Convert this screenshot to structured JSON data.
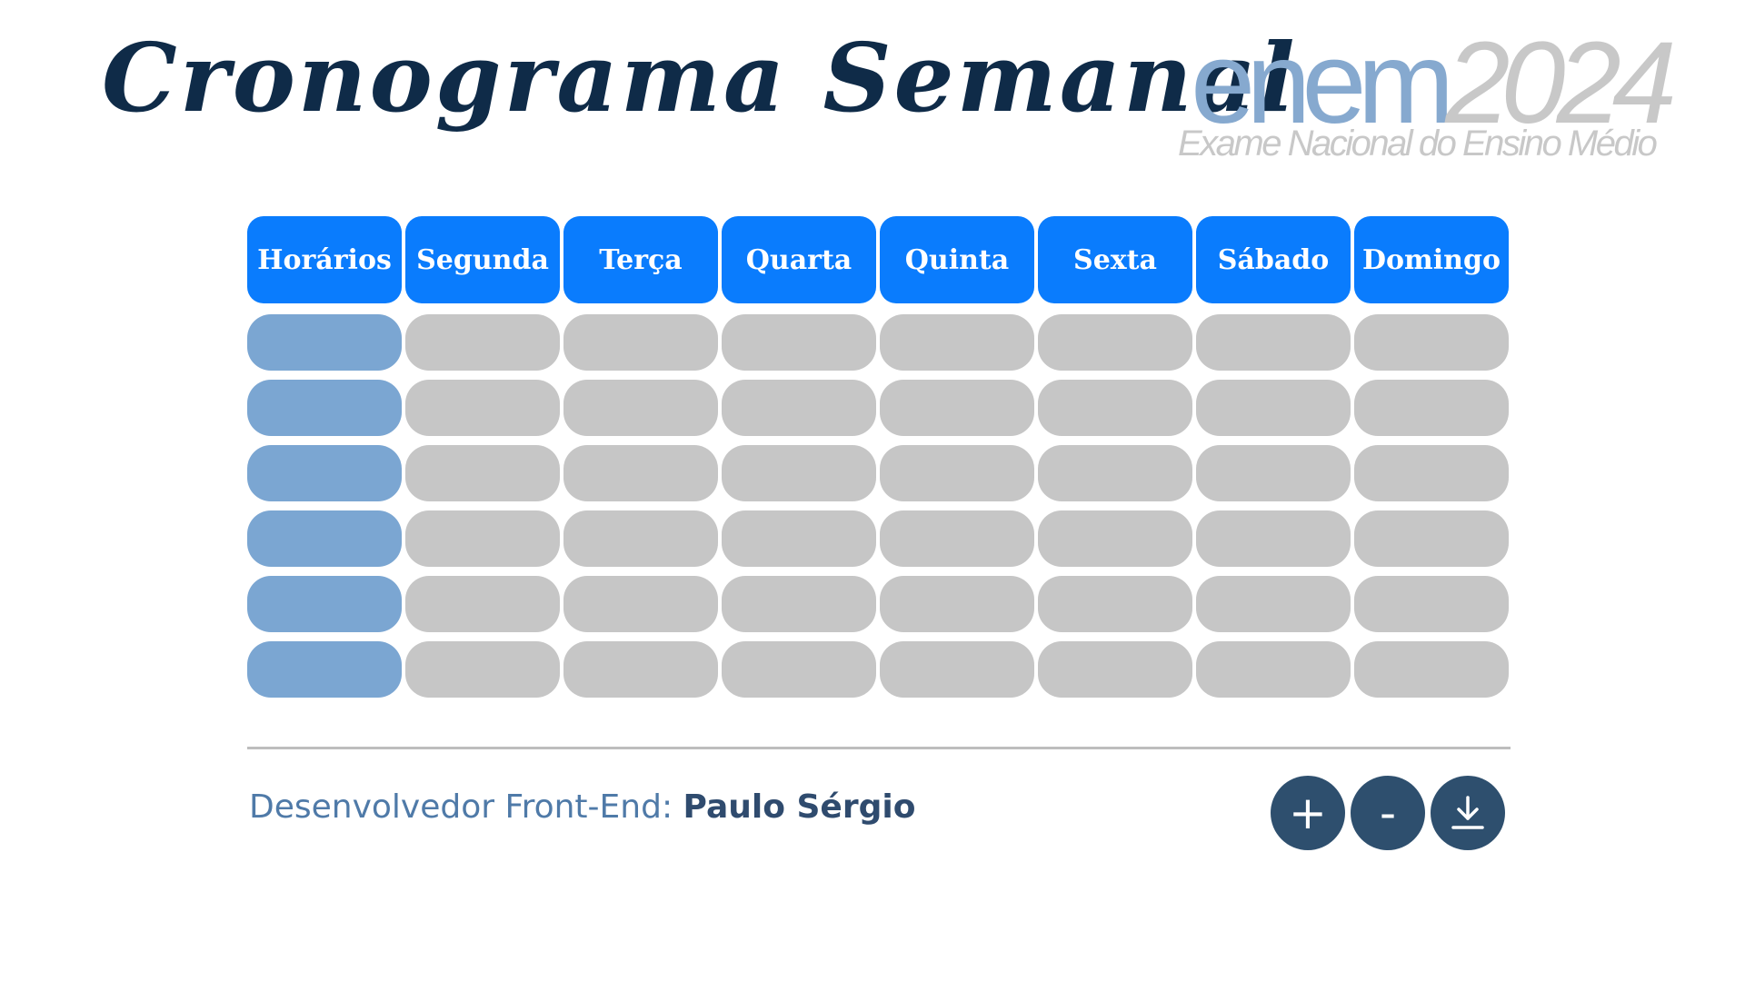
{
  "title": "Cronograma Semanal",
  "logo": {
    "word": "enem",
    "year": "2024",
    "subtitle": "Exame Nacional do Ensino Médio"
  },
  "schedule": {
    "headers": [
      "Horários",
      "Segunda",
      "Terça",
      "Quarta",
      "Quinta",
      "Sexta",
      "Sábado",
      "Domingo"
    ],
    "rows": [
      [
        "",
        "",
        "",
        "",
        "",
        "",
        "",
        ""
      ],
      [
        "",
        "",
        "",
        "",
        "",
        "",
        "",
        ""
      ],
      [
        "",
        "",
        "",
        "",
        "",
        "",
        "",
        ""
      ],
      [
        "",
        "",
        "",
        "",
        "",
        "",
        "",
        ""
      ],
      [
        "",
        "",
        "",
        "",
        "",
        "",
        "",
        ""
      ],
      [
        "",
        "",
        "",
        "",
        "",
        "",
        "",
        ""
      ]
    ]
  },
  "footer": {
    "credit_label": "Desenvolvedor Front-End:",
    "credit_name": "Paulo Sérgio"
  },
  "actions": {
    "add_symbol": "+",
    "remove_symbol": "-",
    "download_icon": "download-icon"
  },
  "colors": {
    "title": "#0f2b48",
    "header": "#0a7cfd",
    "time_cell": "#7ba6d2",
    "slot_cell": "#c6c6c6",
    "button": "#2e4f6e",
    "credit": "#4f7aa8",
    "logo_word": "#86a9cf",
    "logo_year": "#c8c8c8"
  }
}
